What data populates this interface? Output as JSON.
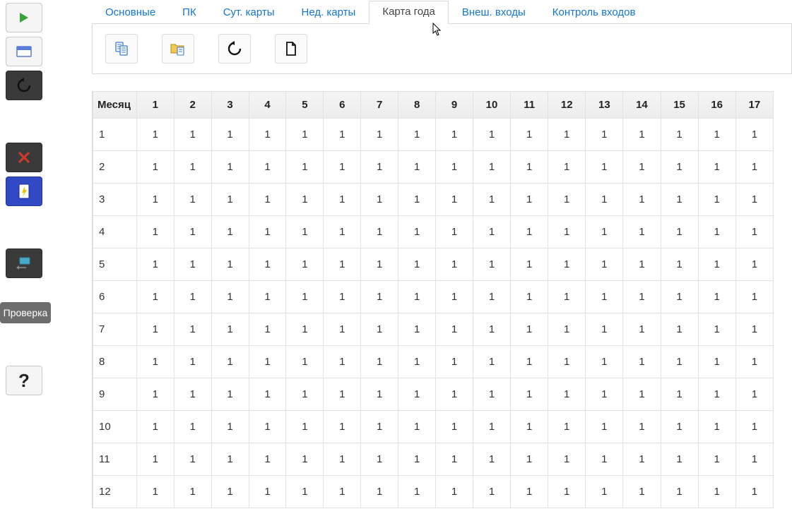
{
  "sidebar": {
    "check_label": "Проверка"
  },
  "tabs": [
    {
      "label": "Основные",
      "active": false
    },
    {
      "label": "ПК",
      "active": false
    },
    {
      "label": "Сут. карты",
      "active": false
    },
    {
      "label": "Нед. карты",
      "active": false
    },
    {
      "label": "Карта года",
      "active": true
    },
    {
      "label": "Внеш. входы",
      "active": false
    },
    {
      "label": "Контроль входов",
      "active": false
    }
  ],
  "table": {
    "month_header": "Месяц",
    "columns": [
      "1",
      "2",
      "3",
      "4",
      "5",
      "6",
      "7",
      "8",
      "9",
      "10",
      "11",
      "12",
      "13",
      "14",
      "15",
      "16",
      "17"
    ],
    "rows": [
      {
        "month": "1",
        "cells": [
          "1",
          "1",
          "1",
          "1",
          "1",
          "1",
          "1",
          "1",
          "1",
          "1",
          "1",
          "1",
          "1",
          "1",
          "1",
          "1",
          "1"
        ]
      },
      {
        "month": "2",
        "cells": [
          "1",
          "1",
          "1",
          "1",
          "1",
          "1",
          "1",
          "1",
          "1",
          "1",
          "1",
          "1",
          "1",
          "1",
          "1",
          "1",
          "1"
        ]
      },
      {
        "month": "3",
        "cells": [
          "1",
          "1",
          "1",
          "1",
          "1",
          "1",
          "1",
          "1",
          "1",
          "1",
          "1",
          "1",
          "1",
          "1",
          "1",
          "1",
          "1"
        ]
      },
      {
        "month": "4",
        "cells": [
          "1",
          "1",
          "1",
          "1",
          "1",
          "1",
          "1",
          "1",
          "1",
          "1",
          "1",
          "1",
          "1",
          "1",
          "1",
          "1",
          "1"
        ]
      },
      {
        "month": "5",
        "cells": [
          "1",
          "1",
          "1",
          "1",
          "1",
          "1",
          "1",
          "1",
          "1",
          "1",
          "1",
          "1",
          "1",
          "1",
          "1",
          "1",
          "1"
        ]
      },
      {
        "month": "6",
        "cells": [
          "1",
          "1",
          "1",
          "1",
          "1",
          "1",
          "1",
          "1",
          "1",
          "1",
          "1",
          "1",
          "1",
          "1",
          "1",
          "1",
          "1"
        ]
      },
      {
        "month": "7",
        "cells": [
          "1",
          "1",
          "1",
          "1",
          "1",
          "1",
          "1",
          "1",
          "1",
          "1",
          "1",
          "1",
          "1",
          "1",
          "1",
          "1",
          "1"
        ]
      },
      {
        "month": "8",
        "cells": [
          "1",
          "1",
          "1",
          "1",
          "1",
          "1",
          "1",
          "1",
          "1",
          "1",
          "1",
          "1",
          "1",
          "1",
          "1",
          "1",
          "1"
        ]
      },
      {
        "month": "9",
        "cells": [
          "1",
          "1",
          "1",
          "1",
          "1",
          "1",
          "1",
          "1",
          "1",
          "1",
          "1",
          "1",
          "1",
          "1",
          "1",
          "1",
          "1"
        ]
      },
      {
        "month": "10",
        "cells": [
          "1",
          "1",
          "1",
          "1",
          "1",
          "1",
          "1",
          "1",
          "1",
          "1",
          "1",
          "1",
          "1",
          "1",
          "1",
          "1",
          "1"
        ]
      },
      {
        "month": "11",
        "cells": [
          "1",
          "1",
          "1",
          "1",
          "1",
          "1",
          "1",
          "1",
          "1",
          "1",
          "1",
          "1",
          "1",
          "1",
          "1",
          "1",
          "1"
        ]
      },
      {
        "month": "12",
        "cells": [
          "1",
          "1",
          "1",
          "1",
          "1",
          "1",
          "1",
          "1",
          "1",
          "1",
          "1",
          "1",
          "1",
          "1",
          "1",
          "1",
          "1"
        ]
      }
    ]
  },
  "help_label": "?"
}
